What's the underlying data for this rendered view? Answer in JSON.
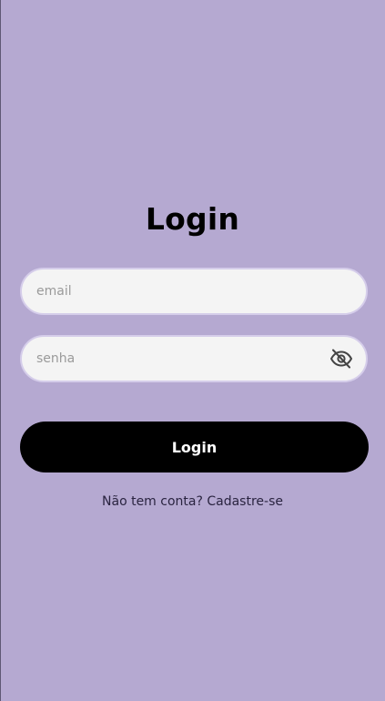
{
  "screen": {
    "title": "Login"
  },
  "form": {
    "email_placeholder": "email",
    "password_placeholder": "senha",
    "password_toggle_icon": "eye-off-icon",
    "submit_label": "Login"
  },
  "footer": {
    "prompt": "Não tem conta? ",
    "signup_link": "Cadastre-se"
  },
  "colors": {
    "background": "#b5a9d1",
    "input_background": "#f4f4f4",
    "input_border": "#d5cdea",
    "button_background": "#000000",
    "button_text": "#ffffff"
  }
}
